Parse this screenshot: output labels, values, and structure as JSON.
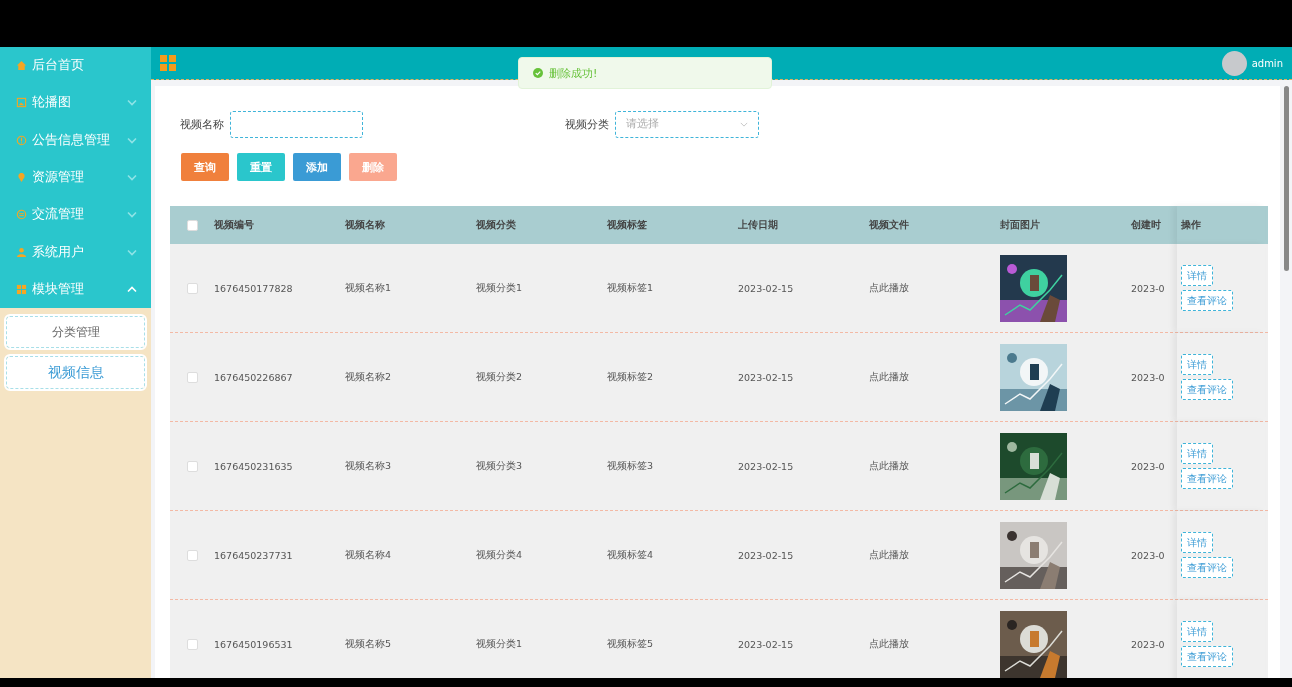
{
  "sidebar": {
    "items": [
      {
        "label": "后台首页"
      },
      {
        "label": "轮播图",
        "expanded": false
      },
      {
        "label": "公告信息管理",
        "expanded": false
      },
      {
        "label": "资源管理",
        "expanded": false
      },
      {
        "label": "交流管理",
        "expanded": false
      },
      {
        "label": "系统用户",
        "expanded": false
      },
      {
        "label": "模块管理",
        "expanded": true,
        "children": [
          {
            "label": "分类管理",
            "selected": false
          },
          {
            "label": "视频信息",
            "selected": true
          }
        ]
      }
    ]
  },
  "header": {
    "user": "admin"
  },
  "toast": {
    "message": "删除成功!"
  },
  "search": {
    "fields": [
      {
        "label": "视频名称",
        "kind": "text"
      },
      {
        "label": "视频分类",
        "kind": "select",
        "placeholder": "请选择"
      }
    ],
    "buttons": [
      {
        "label": "查询",
        "kind": "search",
        "disabled": false
      },
      {
        "label": "重置",
        "kind": "reset",
        "disabled": false
      },
      {
        "label": "添加",
        "kind": "add",
        "disabled": false
      },
      {
        "label": "删除",
        "kind": "delete",
        "disabled": true
      }
    ]
  },
  "table": {
    "select_all": {
      "checked": false
    },
    "columns": [
      "视频编号",
      "视频名称",
      "视频分类",
      "视频标签",
      "上传日期",
      "视频文件",
      "封面图片",
      "创建时",
      "操作"
    ],
    "rows": [
      {
        "checked": false,
        "cells": [
          "1676450177828",
          "视频名称1",
          "视频分类1",
          "视频标签1",
          "2023-02-15",
          "点此播放"
        ],
        "cover": {
          "kind": "picture"
        },
        "created": "2023-0",
        "actions": [
          "详情",
          "查看评论"
        ]
      },
      {
        "checked": false,
        "cells": [
          "1676450226867",
          "视频名称2",
          "视频分类2",
          "视频标签2",
          "2023-02-15",
          "点此播放"
        ],
        "cover": {
          "kind": "picture"
        },
        "created": "2023-0",
        "actions": [
          "详情",
          "查看评论"
        ]
      },
      {
        "checked": false,
        "cells": [
          "1676450231635",
          "视频名称3",
          "视频分类3",
          "视频标签3",
          "2023-02-15",
          "点此播放"
        ],
        "cover": {
          "kind": "picture"
        },
        "created": "2023-0",
        "actions": [
          "详情",
          "查看评论"
        ]
      },
      {
        "checked": false,
        "cells": [
          "1676450237731",
          "视频名称4",
          "视频分类4",
          "视频标签4",
          "2023-02-15",
          "点此播放"
        ],
        "cover": {
          "kind": "picture"
        },
        "created": "2023-0",
        "actions": [
          "详情",
          "查看评论"
        ]
      },
      {
        "checked": false,
        "cells": [
          "1676450196531",
          "视频名称5",
          "视频分类1",
          "视频标签5",
          "2023-02-15",
          "点此播放"
        ],
        "cover": {
          "kind": "picture"
        },
        "created": "2023-0",
        "actions": [
          "详情",
          "查看评论"
        ]
      }
    ]
  }
}
